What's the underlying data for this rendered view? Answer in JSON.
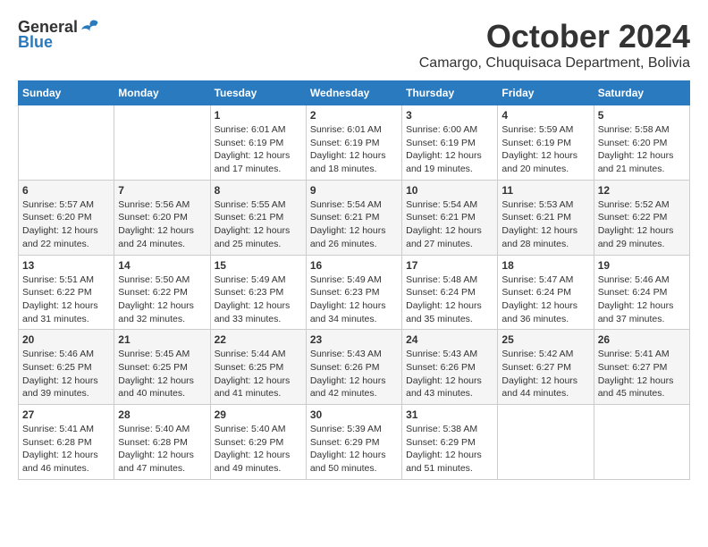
{
  "header": {
    "logo_general": "General",
    "logo_blue": "Blue",
    "month_title": "October 2024",
    "location": "Camargo, Chuquisaca Department, Bolivia"
  },
  "columns": [
    "Sunday",
    "Monday",
    "Tuesday",
    "Wednesday",
    "Thursday",
    "Friday",
    "Saturday"
  ],
  "weeks": [
    [
      {
        "day": "",
        "sunrise": "",
        "sunset": "",
        "daylight": ""
      },
      {
        "day": "",
        "sunrise": "",
        "sunset": "",
        "daylight": ""
      },
      {
        "day": "1",
        "sunrise": "Sunrise: 6:01 AM",
        "sunset": "Sunset: 6:19 PM",
        "daylight": "Daylight: 12 hours and 17 minutes."
      },
      {
        "day": "2",
        "sunrise": "Sunrise: 6:01 AM",
        "sunset": "Sunset: 6:19 PM",
        "daylight": "Daylight: 12 hours and 18 minutes."
      },
      {
        "day": "3",
        "sunrise": "Sunrise: 6:00 AM",
        "sunset": "Sunset: 6:19 PM",
        "daylight": "Daylight: 12 hours and 19 minutes."
      },
      {
        "day": "4",
        "sunrise": "Sunrise: 5:59 AM",
        "sunset": "Sunset: 6:19 PM",
        "daylight": "Daylight: 12 hours and 20 minutes."
      },
      {
        "day": "5",
        "sunrise": "Sunrise: 5:58 AM",
        "sunset": "Sunset: 6:20 PM",
        "daylight": "Daylight: 12 hours and 21 minutes."
      }
    ],
    [
      {
        "day": "6",
        "sunrise": "Sunrise: 5:57 AM",
        "sunset": "Sunset: 6:20 PM",
        "daylight": "Daylight: 12 hours and 22 minutes."
      },
      {
        "day": "7",
        "sunrise": "Sunrise: 5:56 AM",
        "sunset": "Sunset: 6:20 PM",
        "daylight": "Daylight: 12 hours and 24 minutes."
      },
      {
        "day": "8",
        "sunrise": "Sunrise: 5:55 AM",
        "sunset": "Sunset: 6:21 PM",
        "daylight": "Daylight: 12 hours and 25 minutes."
      },
      {
        "day": "9",
        "sunrise": "Sunrise: 5:54 AM",
        "sunset": "Sunset: 6:21 PM",
        "daylight": "Daylight: 12 hours and 26 minutes."
      },
      {
        "day": "10",
        "sunrise": "Sunrise: 5:54 AM",
        "sunset": "Sunset: 6:21 PM",
        "daylight": "Daylight: 12 hours and 27 minutes."
      },
      {
        "day": "11",
        "sunrise": "Sunrise: 5:53 AM",
        "sunset": "Sunset: 6:21 PM",
        "daylight": "Daylight: 12 hours and 28 minutes."
      },
      {
        "day": "12",
        "sunrise": "Sunrise: 5:52 AM",
        "sunset": "Sunset: 6:22 PM",
        "daylight": "Daylight: 12 hours and 29 minutes."
      }
    ],
    [
      {
        "day": "13",
        "sunrise": "Sunrise: 5:51 AM",
        "sunset": "Sunset: 6:22 PM",
        "daylight": "Daylight: 12 hours and 31 minutes."
      },
      {
        "day": "14",
        "sunrise": "Sunrise: 5:50 AM",
        "sunset": "Sunset: 6:22 PM",
        "daylight": "Daylight: 12 hours and 32 minutes."
      },
      {
        "day": "15",
        "sunrise": "Sunrise: 5:49 AM",
        "sunset": "Sunset: 6:23 PM",
        "daylight": "Daylight: 12 hours and 33 minutes."
      },
      {
        "day": "16",
        "sunrise": "Sunrise: 5:49 AM",
        "sunset": "Sunset: 6:23 PM",
        "daylight": "Daylight: 12 hours and 34 minutes."
      },
      {
        "day": "17",
        "sunrise": "Sunrise: 5:48 AM",
        "sunset": "Sunset: 6:24 PM",
        "daylight": "Daylight: 12 hours and 35 minutes."
      },
      {
        "day": "18",
        "sunrise": "Sunrise: 5:47 AM",
        "sunset": "Sunset: 6:24 PM",
        "daylight": "Daylight: 12 hours and 36 minutes."
      },
      {
        "day": "19",
        "sunrise": "Sunrise: 5:46 AM",
        "sunset": "Sunset: 6:24 PM",
        "daylight": "Daylight: 12 hours and 37 minutes."
      }
    ],
    [
      {
        "day": "20",
        "sunrise": "Sunrise: 5:46 AM",
        "sunset": "Sunset: 6:25 PM",
        "daylight": "Daylight: 12 hours and 39 minutes."
      },
      {
        "day": "21",
        "sunrise": "Sunrise: 5:45 AM",
        "sunset": "Sunset: 6:25 PM",
        "daylight": "Daylight: 12 hours and 40 minutes."
      },
      {
        "day": "22",
        "sunrise": "Sunrise: 5:44 AM",
        "sunset": "Sunset: 6:25 PM",
        "daylight": "Daylight: 12 hours and 41 minutes."
      },
      {
        "day": "23",
        "sunrise": "Sunrise: 5:43 AM",
        "sunset": "Sunset: 6:26 PM",
        "daylight": "Daylight: 12 hours and 42 minutes."
      },
      {
        "day": "24",
        "sunrise": "Sunrise: 5:43 AM",
        "sunset": "Sunset: 6:26 PM",
        "daylight": "Daylight: 12 hours and 43 minutes."
      },
      {
        "day": "25",
        "sunrise": "Sunrise: 5:42 AM",
        "sunset": "Sunset: 6:27 PM",
        "daylight": "Daylight: 12 hours and 44 minutes."
      },
      {
        "day": "26",
        "sunrise": "Sunrise: 5:41 AM",
        "sunset": "Sunset: 6:27 PM",
        "daylight": "Daylight: 12 hours and 45 minutes."
      }
    ],
    [
      {
        "day": "27",
        "sunrise": "Sunrise: 5:41 AM",
        "sunset": "Sunset: 6:28 PM",
        "daylight": "Daylight: 12 hours and 46 minutes."
      },
      {
        "day": "28",
        "sunrise": "Sunrise: 5:40 AM",
        "sunset": "Sunset: 6:28 PM",
        "daylight": "Daylight: 12 hours and 47 minutes."
      },
      {
        "day": "29",
        "sunrise": "Sunrise: 5:40 AM",
        "sunset": "Sunset: 6:29 PM",
        "daylight": "Daylight: 12 hours and 49 minutes."
      },
      {
        "day": "30",
        "sunrise": "Sunrise: 5:39 AM",
        "sunset": "Sunset: 6:29 PM",
        "daylight": "Daylight: 12 hours and 50 minutes."
      },
      {
        "day": "31",
        "sunrise": "Sunrise: 5:38 AM",
        "sunset": "Sunset: 6:29 PM",
        "daylight": "Daylight: 12 hours and 51 minutes."
      },
      {
        "day": "",
        "sunrise": "",
        "sunset": "",
        "daylight": ""
      },
      {
        "day": "",
        "sunrise": "",
        "sunset": "",
        "daylight": ""
      }
    ]
  ]
}
